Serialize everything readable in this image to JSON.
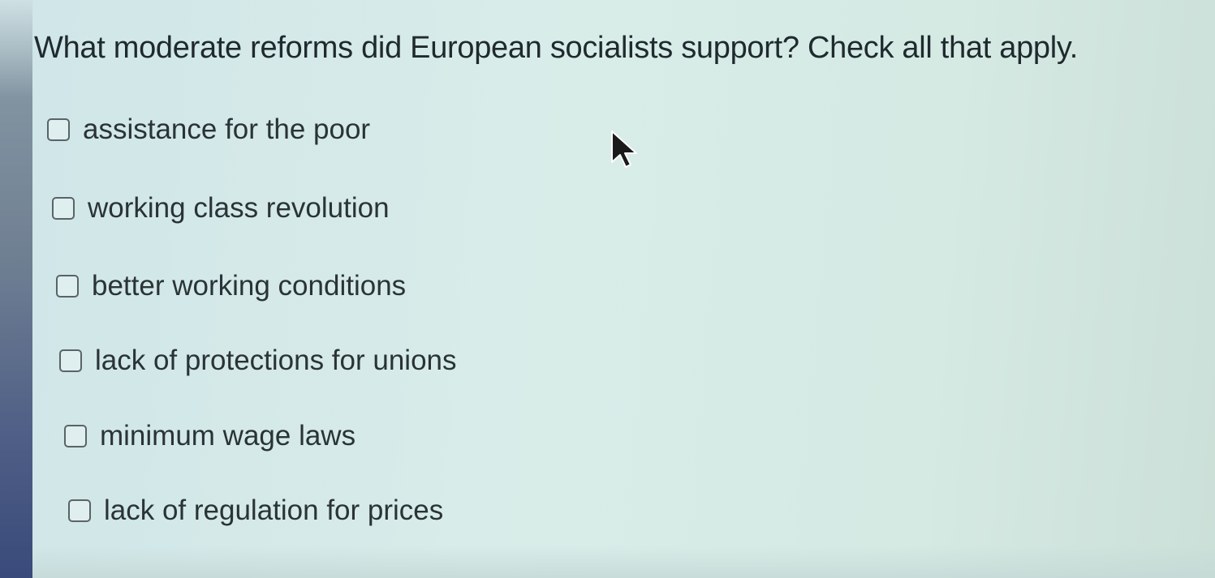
{
  "question": "What moderate reforms did European socialists support? Check all that apply.",
  "options": [
    {
      "label": "assistance for the poor",
      "checked": false
    },
    {
      "label": "working class revolution",
      "checked": false
    },
    {
      "label": "better working conditions",
      "checked": false
    },
    {
      "label": "lack of protections for unions",
      "checked": false
    },
    {
      "label": "minimum wage laws",
      "checked": false
    },
    {
      "label": "lack of regulation for prices",
      "checked": false
    }
  ]
}
